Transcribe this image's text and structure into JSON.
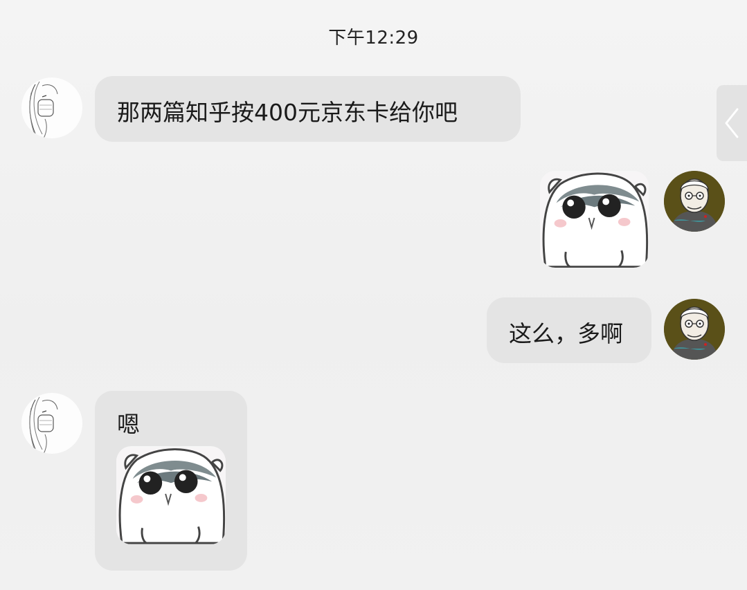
{
  "chat": {
    "timestamp": "下午12:29",
    "messages": [
      {
        "side": "left",
        "type": "text",
        "text": "那两篇知乎按400元京东卡给你吧"
      },
      {
        "side": "right",
        "type": "sticker",
        "sticker_icon": "hamster-sticker-icon"
      },
      {
        "side": "right",
        "type": "text",
        "text": "这么，多啊"
      },
      {
        "side": "left",
        "type": "text+sticker",
        "text": "嗯",
        "sticker_icon": "hamster-sticker-icon"
      }
    ],
    "avatars": {
      "left": "masked-girl-sketch-avatar",
      "right": "old-man-cartoon-avatar"
    }
  },
  "ui": {
    "side_handle_icon": "chevron-left-icon",
    "bubble_color": "#e4e4e4"
  }
}
